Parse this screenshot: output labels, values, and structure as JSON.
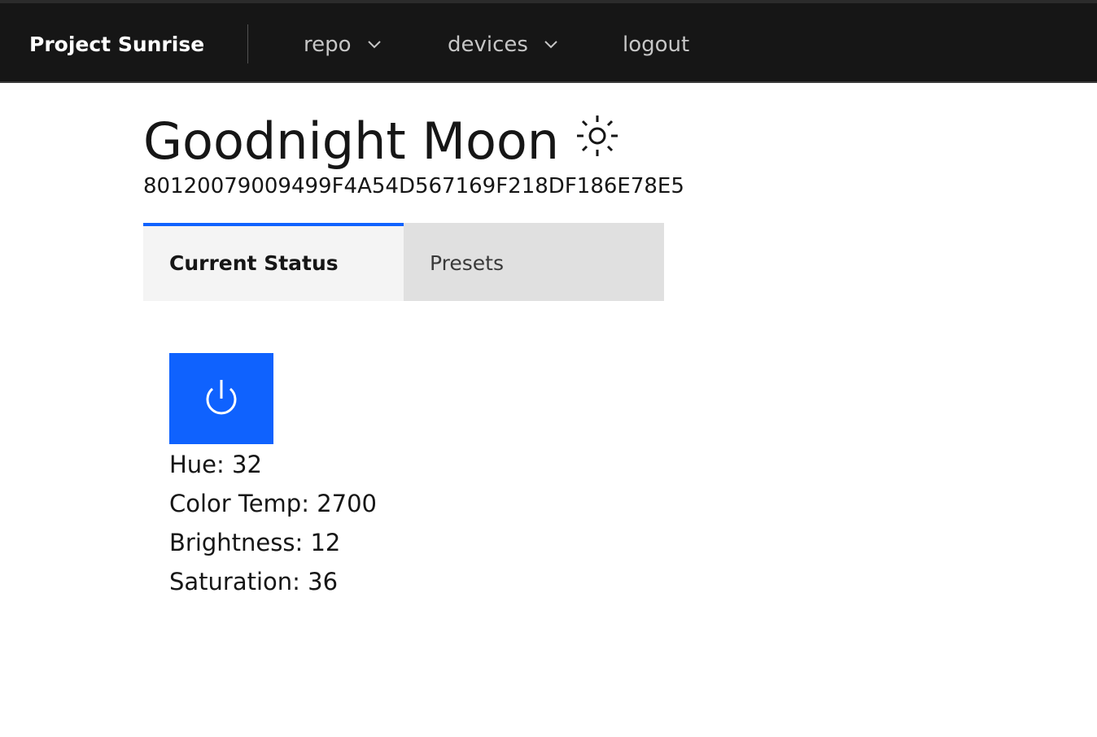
{
  "app": {
    "brand": "Project Sunrise"
  },
  "nav": {
    "items": [
      {
        "label": "repo",
        "has_dropdown": true,
        "icon": "chevron-down-icon"
      },
      {
        "label": "devices",
        "has_dropdown": true,
        "icon": "chevron-down-icon"
      },
      {
        "label": "logout",
        "has_dropdown": false
      }
    ]
  },
  "device": {
    "name": "Goodnight Moon",
    "status_icon": "sun-icon",
    "id": "80120079009499F4A54D567169F218DF186E78E5"
  },
  "tabs": [
    {
      "label": "Current Status",
      "active": true
    },
    {
      "label": "Presets",
      "active": false
    }
  ],
  "power": {
    "icon": "power-icon",
    "color": "#0f62fe"
  },
  "status": {
    "hue": "Hue: 32",
    "color_temp": "Color Temp: 2700",
    "brightness": "Brightness: 12",
    "saturation": "Saturation: 36"
  },
  "colors": {
    "header_background": "#161616",
    "accent": "#0f62fe",
    "active_tab": "#f4f4f4",
    "inactive_tab": "#e0e0e0"
  }
}
